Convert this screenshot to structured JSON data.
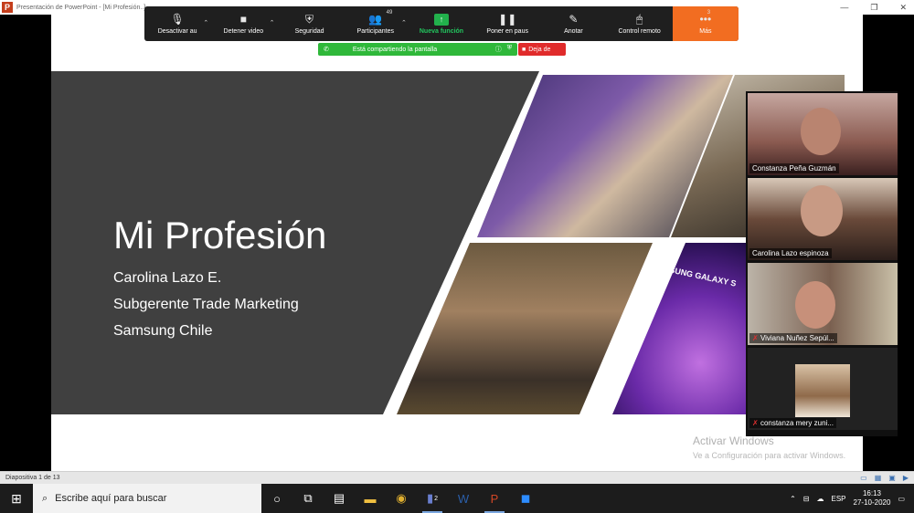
{
  "window": {
    "title": "Presentación de PowerPoint - [Mi Profesión..]",
    "icon": "powerpoint-icon",
    "controls": [
      "—",
      "❐",
      "✕"
    ]
  },
  "slide": {
    "title": "Mi Profesión",
    "lines": [
      "Carolina Lazo E.",
      "Subgerente Trade Marketing",
      "Samsung Chile"
    ],
    "photo_text": "SAMSUNG GALAXY S",
    "dark_color": "#404040"
  },
  "watermark": {
    "line1": "Activar Windows",
    "line2": "Ve a Configuración para activar Windows."
  },
  "zoom_toolbar": {
    "items": [
      {
        "label": "Desactivar au",
        "icon": "🎙",
        "caret": true
      },
      {
        "label": "Detener video",
        "icon": "■",
        "caret": true
      },
      {
        "label": "Seguridad",
        "icon": "⛨",
        "caret": false
      },
      {
        "label": "Participantes",
        "icon": "👥",
        "badge": "49",
        "caret": true
      },
      {
        "label": "Nueva función",
        "icon": "↑",
        "caret": false,
        "new": true
      },
      {
        "label": "Poner en paus",
        "icon": "❚❚",
        "caret": false
      },
      {
        "label": "Anotar",
        "icon": "✎",
        "caret": false
      },
      {
        "label": "Control remoto",
        "icon": "🖱",
        "caret": false
      },
      {
        "label": "Más",
        "icon": "•••",
        "badge": "3",
        "caret": false,
        "more": true
      }
    ],
    "accent_new": "#22b14c",
    "accent_more": "#f26d21"
  },
  "share": {
    "text": "Está compartiendo la pantalla",
    "stop_label": "Deja de"
  },
  "participants": [
    {
      "name": "Constanza Peña Guzmán"
    },
    {
      "name": "Carolina Lazo espinoza"
    },
    {
      "name": "Viviana Nuñez Sepúl..."
    },
    {
      "name": "constanza mery zuni..."
    }
  ],
  "statusbar": {
    "left": "Diapositiva 1 de 13"
  },
  "taskbar": {
    "search_placeholder": "Escribe aquí para buscar",
    "teams_badge": "2",
    "lang": "ESP",
    "time": "16:13",
    "date": "27-10-2020"
  }
}
